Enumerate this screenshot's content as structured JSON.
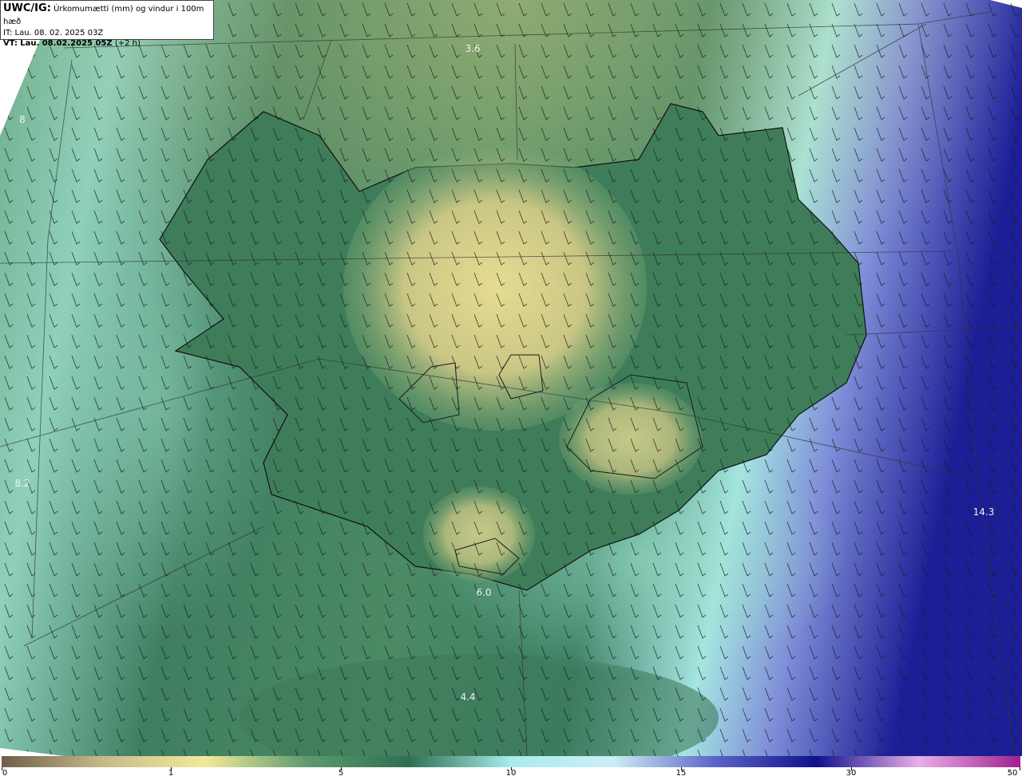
{
  "header": {
    "model": "UWC/IG:",
    "title": "Úrkomumætti (mm) og vindur i 100m hæð",
    "it_label": "IT:",
    "it_value": "Lau. 08. 02. 2025 03Z",
    "vt_label": "VT:",
    "vt_value": "Lau. 08.02.2025 05Z",
    "vt_offset": "(+2 h)"
  },
  "map_labels": [
    "3.6",
    "8",
    "8.2",
    "6.0",
    "4.4",
    "14.3"
  ],
  "colorbar": {
    "ticks": [
      "0",
      "1",
      "5",
      "10",
      "15",
      "30",
      "50"
    ],
    "colors": [
      "#6e5f4a",
      "#c9b98a",
      "#f2ea9a",
      "#5d9a6e",
      "#2f6f52",
      "#a8ecec",
      "#cdeef6",
      "#5b64c8",
      "#10108a",
      "#e8b0e8",
      "#a0208f"
    ]
  }
}
